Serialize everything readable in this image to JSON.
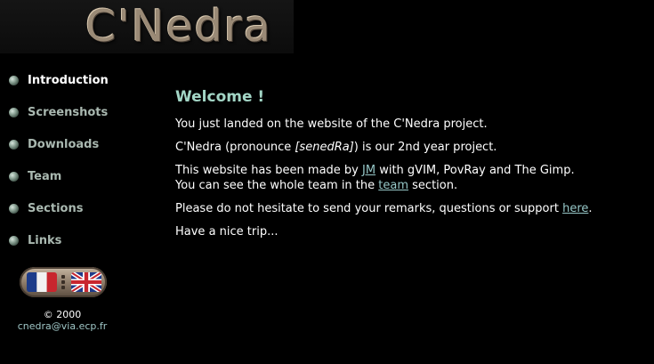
{
  "logo": {
    "text": "C'Nedra"
  },
  "nav": {
    "items": [
      {
        "label": "Introduction",
        "active": true
      },
      {
        "label": "Screenshots"
      },
      {
        "label": "Downloads"
      },
      {
        "label": "Team"
      },
      {
        "label": "Sections"
      },
      {
        "label": "Links"
      }
    ]
  },
  "language": {
    "flags": [
      "france-flag",
      "uk-flag"
    ]
  },
  "footer": {
    "copyright": "© 2000",
    "email": "cnedra@via.ecp.fr"
  },
  "main": {
    "heading": "Welcome !",
    "p1": "You just landed on the website of the C'Nedra project.",
    "p2_before": "C'Nedra (pronounce ",
    "p2_pron": "[senedRa]",
    "p2_after": ") is our 2nd year project.",
    "p3_before": "This website has been made by ",
    "p3_link": "JM",
    "p3_after": " with gVIM, PovRay and The Gimp.",
    "p4_before": "You can see the whole team in the ",
    "p4_link": "team",
    "p4_after": " section.",
    "p5_before": "Please do not hesitate to send your remarks, questions or support ",
    "p5_link": "here",
    "p5_after": ".",
    "p6": "Have a nice trip..."
  }
}
